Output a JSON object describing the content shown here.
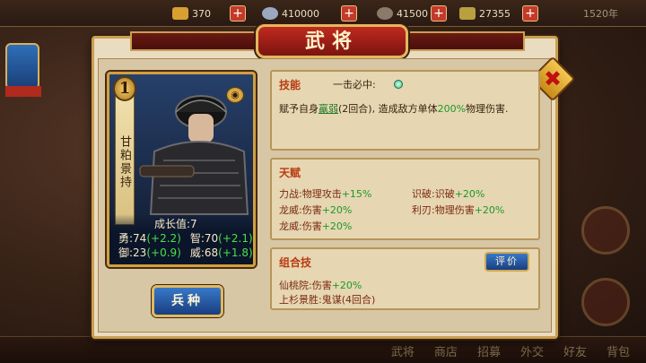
{
  "topbar": {
    "resources": [
      {
        "icon": "gold-bar-icon",
        "value": "370"
      },
      {
        "icon": "silver-coin-icon",
        "value": "410000"
      },
      {
        "icon": "food-sack-icon",
        "value": "41500"
      },
      {
        "icon": "grain-icon",
        "value": "27355"
      }
    ],
    "year": "1520年"
  },
  "dialog": {
    "title": "武将"
  },
  "hero": {
    "rank": "1",
    "name": "甘粕景持",
    "growth": "成长值:7",
    "stats": {
      "brave": "勇:74",
      "brave_bonus": "(+2.2)",
      "wisdom": "智:70",
      "wisdom_bonus": "(+2.1)",
      "defense": "御:23",
      "defense_bonus": "(+0.9)",
      "power": "威:68",
      "power_bonus": "(+1.8)"
    }
  },
  "unit_button": "兵种",
  "skill": {
    "header": "技能",
    "name": "一击必中:",
    "desc_prefix": "赋予自身",
    "desc_status": "羸弱",
    "desc_mid": "(2回合), 造成敌方单体",
    "desc_pct": "200%",
    "desc_suffix": "物理伤害."
  },
  "talents": {
    "header": "天赋",
    "items": [
      {
        "label": "力战:物理攻击",
        "bonus": "+15%"
      },
      {
        "label": "识破:识破",
        "bonus": "+20%"
      },
      {
        "label": "龙威:伤害",
        "bonus": "+20%"
      },
      {
        "label": "利刃:物理伤害",
        "bonus": "+20%"
      },
      {
        "label": "龙威:伤害",
        "bonus": "+20%"
      }
    ]
  },
  "combo": {
    "header": "组合技",
    "eval_button": "评价",
    "line1_label": "仙桃院:伤害",
    "line1_bonus": "+20%",
    "line2": "上杉景胜:鬼谋(4回合)"
  },
  "bottom_nav": [
    "武将",
    "商店",
    "招募",
    "外交",
    "好友",
    "背包"
  ]
}
